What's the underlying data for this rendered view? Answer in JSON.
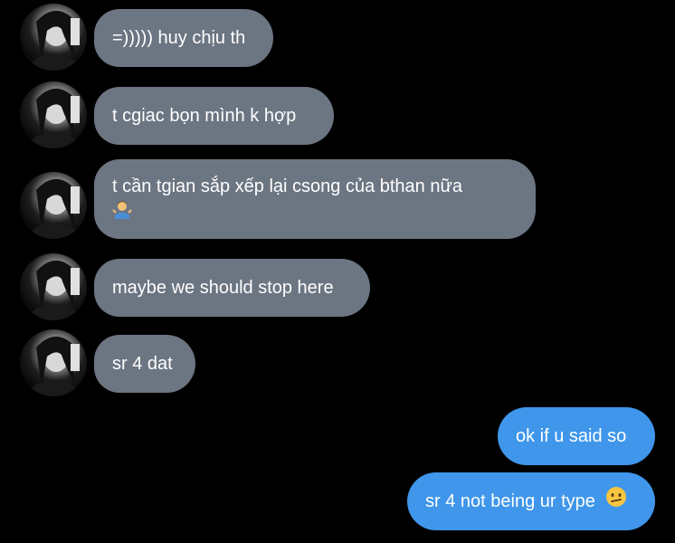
{
  "conversation": {
    "messages": [
      {
        "sender": "them",
        "text": "=))))) huy chịu th"
      },
      {
        "sender": "them",
        "text": "t cgiac bọn mình k hợp"
      },
      {
        "sender": "them",
        "text": "t cần tgian sắp xếp lại csong của bthan nữa",
        "emoji_icon": "person-shrugging-emoji"
      },
      {
        "sender": "them",
        "text": "maybe we should stop here"
      },
      {
        "sender": "them",
        "text": "sr 4 dat"
      },
      {
        "sender": "me",
        "text": "ok if u said so"
      },
      {
        "sender": "me",
        "text": "sr 4 not being ur type",
        "emoji_icon": "confused-face-emoji"
      }
    ]
  },
  "colors": {
    "background": "#000000",
    "incoming_bubble": "#6c7582",
    "outgoing_bubble": "#3f96ea",
    "text": "#ffffff"
  }
}
